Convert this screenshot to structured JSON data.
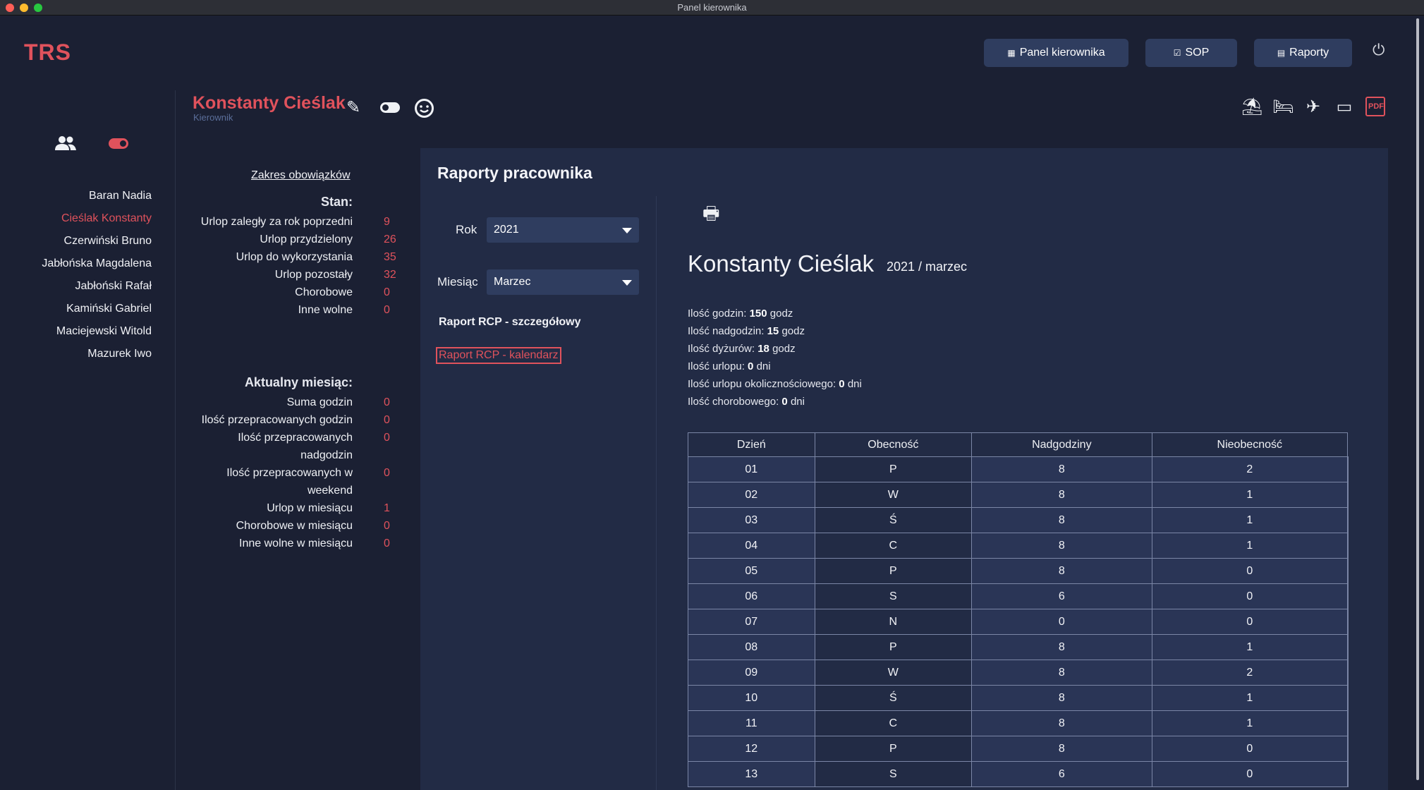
{
  "window": {
    "title": "Panel kierownika"
  },
  "app": {
    "logo": "TRS"
  },
  "nav": {
    "buttons": [
      {
        "icon": "dashboard-icon",
        "glyph": "▦",
        "label": "Panel kierownika"
      },
      {
        "icon": "checkbox-icon",
        "glyph": "☑",
        "label": "SOP"
      },
      {
        "icon": "report-icon",
        "glyph": "▤",
        "label": "Raporty"
      }
    ]
  },
  "sidebar": {
    "employees": [
      {
        "name": "Baran Nadia",
        "active": false
      },
      {
        "name": "Cieślak Konstanty",
        "active": true
      },
      {
        "name": "Czerwiński Bruno",
        "active": false
      },
      {
        "name": "Jabłońska Magdalena",
        "active": false
      },
      {
        "name": "Jabłoński Rafał",
        "active": false
      },
      {
        "name": "Kamiński Gabriel",
        "active": false
      },
      {
        "name": "Maciejewski Witold",
        "active": false
      },
      {
        "name": "Mazurek Iwo",
        "active": false
      }
    ]
  },
  "employee": {
    "name": "Konstanty Cieślak",
    "role": "Kierownik"
  },
  "stats": {
    "scope_link": "Zakres obowiązków",
    "status_heading": "Stan:",
    "status_rows": [
      {
        "label": "Urlop zaległy za rok poprzedni",
        "value": "9"
      },
      {
        "label": "Urlop przydzielony",
        "value": "26"
      },
      {
        "label": "Urlop do wykorzystania",
        "value": "35"
      },
      {
        "label": "Urlop pozostały",
        "value": "32"
      },
      {
        "label": "Chorobowe",
        "value": "0"
      },
      {
        "label": "Inne wolne",
        "value": "0"
      }
    ],
    "month_heading": "Aktualny miesiąc:",
    "month_rows": [
      {
        "label": "Suma godzin",
        "value": "0"
      },
      {
        "label": "Ilość przepracowanych godzin",
        "value": "0"
      },
      {
        "label": "Ilość przepracowanych nadgodzin",
        "value": "0"
      },
      {
        "label": "Ilość przepracowanych w weekend",
        "value": "0"
      },
      {
        "label": "Urlop w miesiącu",
        "value": "1"
      },
      {
        "label": "Chorobowe w miesiącu",
        "value": "0"
      },
      {
        "label": "Inne wolne w miesiącu",
        "value": "0"
      }
    ]
  },
  "reports": {
    "title": "Raporty pracownika",
    "year_label": "Rok",
    "year_value": "2021",
    "month_label": "Miesiąc",
    "month_value": "Marzec",
    "link_detailed": "Raport RCP - szczegółowy",
    "link_calendar": "Raport RCP - kalendarz"
  },
  "report": {
    "name": "Konstanty Cieślak",
    "period": "2021 / marzec",
    "summary": [
      {
        "label": "Ilość godzin:",
        "value": "150",
        "unit": "godz"
      },
      {
        "label": "Ilość nadgodzin:",
        "value": "15",
        "unit": "godz"
      },
      {
        "label": "Ilość dyżurów:",
        "value": "18",
        "unit": "godz"
      },
      {
        "label": "Ilość urlopu:",
        "value": "0",
        "unit": "dni"
      },
      {
        "label": "Ilość urlopu okolicznościowego:",
        "value": "0",
        "unit": "dni"
      },
      {
        "label": "Ilość chorobowego:",
        "value": "0",
        "unit": "dni"
      }
    ],
    "columns": [
      "Dzień",
      "Obecność",
      "Nadgodziny",
      "Nieobecność"
    ],
    "rows": [
      {
        "day": "01",
        "wd": "P",
        "ob": "8",
        "nd": "2",
        "nb": ""
      },
      {
        "day": "02",
        "wd": "W",
        "ob": "8",
        "nd": "1",
        "nb": ""
      },
      {
        "day": "03",
        "wd": "Ś",
        "ob": "8",
        "nd": "1",
        "nb": ""
      },
      {
        "day": "04",
        "wd": "C",
        "ob": "8",
        "nd": "1",
        "nb": ""
      },
      {
        "day": "05",
        "wd": "P",
        "ob": "8",
        "nd": "0",
        "nb": ""
      },
      {
        "day": "06",
        "wd": "S",
        "ob": "6",
        "nd": "0",
        "nb": ""
      },
      {
        "day": "07",
        "wd": "N",
        "ob": "0",
        "nd": "0",
        "nb": ""
      },
      {
        "day": "08",
        "wd": "P",
        "ob": "8",
        "nd": "1",
        "nb": ""
      },
      {
        "day": "09",
        "wd": "W",
        "ob": "8",
        "nd": "2",
        "nb": ""
      },
      {
        "day": "10",
        "wd": "Ś",
        "ob": "8",
        "nd": "1",
        "nb": ""
      },
      {
        "day": "11",
        "wd": "C",
        "ob": "8",
        "nd": "1",
        "nb": ""
      },
      {
        "day": "12",
        "wd": "P",
        "ob": "8",
        "nd": "0",
        "nb": ""
      },
      {
        "day": "13",
        "wd": "S",
        "ob": "6",
        "nd": "0",
        "nb": ""
      }
    ]
  },
  "colors": {
    "accent": "#e0525c",
    "background": "#1b2033",
    "panel": "#222b45",
    "button": "#2f3d5f"
  }
}
